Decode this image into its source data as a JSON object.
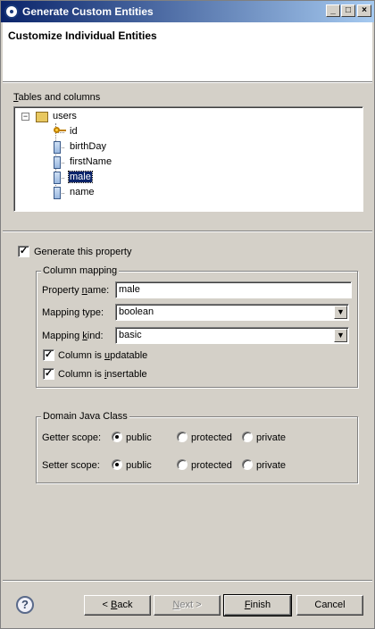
{
  "window": {
    "title": "Generate Custom Entities"
  },
  "header": {
    "heading": "Customize Individual Entities"
  },
  "tree_section": {
    "label_pre": "",
    "label_accel": "T",
    "label_rest": "ables and columns",
    "root": "users",
    "columns": [
      "id",
      "birthDay",
      "firstName",
      "male",
      "name"
    ],
    "selected": "male"
  },
  "generate_property": {
    "label": "Generate this property",
    "checked": true
  },
  "column_mapping": {
    "title": "Column mapping",
    "property_name_label_pre": "Property ",
    "property_name_label_accel": "n",
    "property_name_label_rest": "ame:",
    "property_name_value": "male",
    "mapping_type_label": "Mapping type:",
    "mapping_type_value": "boolean",
    "mapping_kind_label_pre": "Mapping ",
    "mapping_kind_label_accel": "k",
    "mapping_kind_label_rest": "ind:",
    "mapping_kind_value": "basic",
    "updatable_pre": "Column is ",
    "updatable_accel": "u",
    "updatable_rest": "pdatable",
    "updatable_checked": true,
    "insertable_pre": "Column is ",
    "insertable_accel": "i",
    "insertable_rest": "nsertable",
    "insertable_checked": true
  },
  "domain_class": {
    "title": "Domain Java Class",
    "getter_label": "Getter scope:",
    "setter_label": "Setter scope:",
    "options": [
      "public",
      "protected",
      "private"
    ],
    "getter_selected": "public",
    "setter_selected": "public"
  },
  "buttons": {
    "back_pre": "< ",
    "back_accel": "B",
    "back_rest": "ack",
    "next_pre": "",
    "next_accel": "N",
    "next_rest": "ext >",
    "finish_pre": "",
    "finish_accel": "F",
    "finish_rest": "inish",
    "cancel": "Cancel",
    "help_glyph": "?"
  },
  "checkmark": "✓",
  "titlebar_buttons": {
    "minimize": "_",
    "maximize": "□",
    "close": "×"
  }
}
